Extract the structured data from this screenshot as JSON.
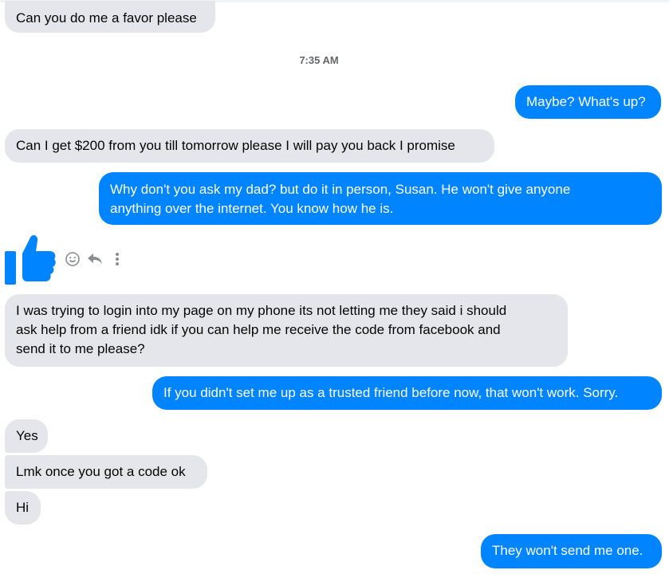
{
  "timestamp": "7:35 AM",
  "messages": {
    "m1": "Can you do me a favor please",
    "m2": "Maybe? What's up?",
    "m3": "Can I get $200 from you till tomorrow please I will pay you back I promise",
    "m4_l1": "Why don't you ask my dad? but do it in person, Susan. He won't give anyone",
    "m4_l2": "anything over the internet. You know how he is.",
    "m5_l1": "I was  trying to login into my page on my phone its not letting me they said i should",
    "m5_l2": "ask help from a friend idk if you can help me receive the code from facebook and",
    "m5_l3": "send it to me please?",
    "m6": "If you didn't set me up as a trusted friend before now, that won't work. Sorry.",
    "m7": "Yes",
    "m8": "Lmk once you got a code ok",
    "m9": "Hi",
    "m10": "They won't send me one."
  },
  "icons": {
    "like": "thumbs-up-icon",
    "react": "smiley-icon",
    "reply": "reply-icon",
    "more": "more-options-icon"
  },
  "colors": {
    "incoming": "#e4e6eb",
    "outgoing": "#0084ff",
    "like": "#0084ff"
  }
}
